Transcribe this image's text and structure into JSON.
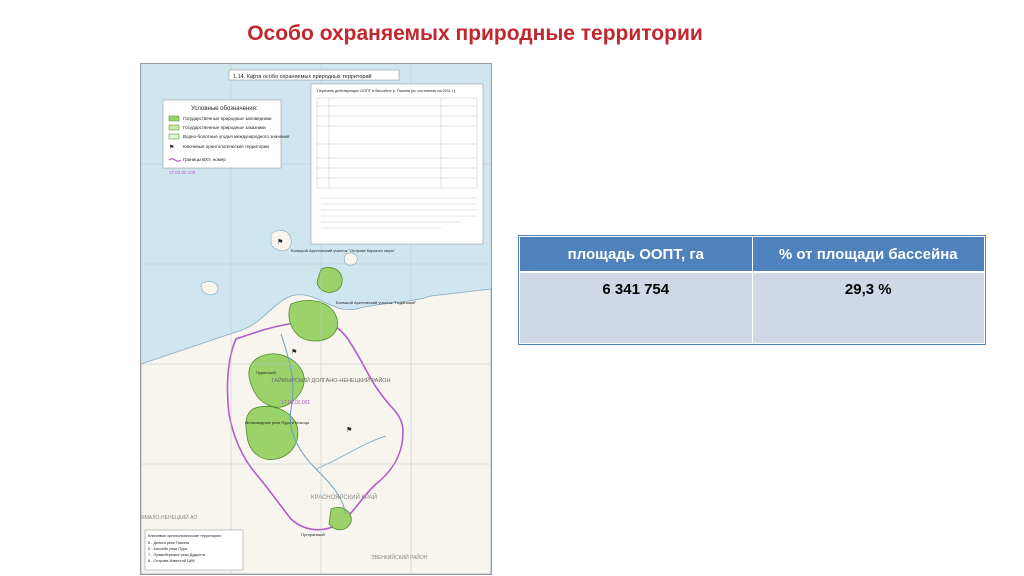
{
  "slide": {
    "title": "Особо охраняемых природные территории"
  },
  "map": {
    "header": "1.14. Карта особо охраняемых природных территорий",
    "legend": {
      "title": "Условные обозначения:",
      "items": [
        "Государственные природные заповедники",
        "Государственные природные заказники",
        "Водно-болотные угодья международного значения",
        "Ключевые орнитологические территории",
        "Границы ВХУ, номер"
      ]
    },
    "labels": {
      "zone_code_1": "17.03.00.100",
      "zone_code_2": "17.03.00.001",
      "bolshoy_arctic_1": "Большой Арктический участок \"Острова Карского моря\"",
      "bolshoy_arctic_2": "Большой Арктический участок \"Гыданский\"",
      "district_taymyr": "ТАЙМЫРСКИЙ ДОЛГАНО-НЕНЕЦКИЙ РАЙОН",
      "purinsky": "Пуринский",
      "mouth_pur": "Мелководные реки Пура и Мокоцо",
      "putoran": "Путоранский",
      "krasnoyarsk": "КРАСНОЯРСКИЙ КРАЙ",
      "yamalo": "ЯМАЛО-НЕНЕЦКИЙ АО",
      "evenkiysky": "ЭВЕНКИЙСКИЙ РАЙОН"
    },
    "bottom_legend": {
      "title": "Ключевые орнитологические территории:",
      "items": [
        "5 - Дельта реки Пясина",
        "6 - Бассейн реки Пура",
        "7 - Правобережье реки Дудыпта",
        "8 - Острова Известий ЦИК"
      ]
    },
    "inset": {
      "title": "Перечень действующих ООПТ в бассейне р. Пясина (по состоянию на 2011 г.)"
    }
  },
  "table": {
    "headers": [
      "площадь ООПТ, га",
      "% от площади бассейна"
    ],
    "rows": [
      [
        "6 341 754",
        "29,3 %"
      ]
    ]
  },
  "colors": {
    "title": "#c0282d",
    "table_header": "#4f81bd",
    "table_cell": "#d0d8e8",
    "sea": "#cfe6ef",
    "land": "#f7f5ee",
    "reserve": "#9bd36a",
    "boundary": "#b45bc7"
  }
}
